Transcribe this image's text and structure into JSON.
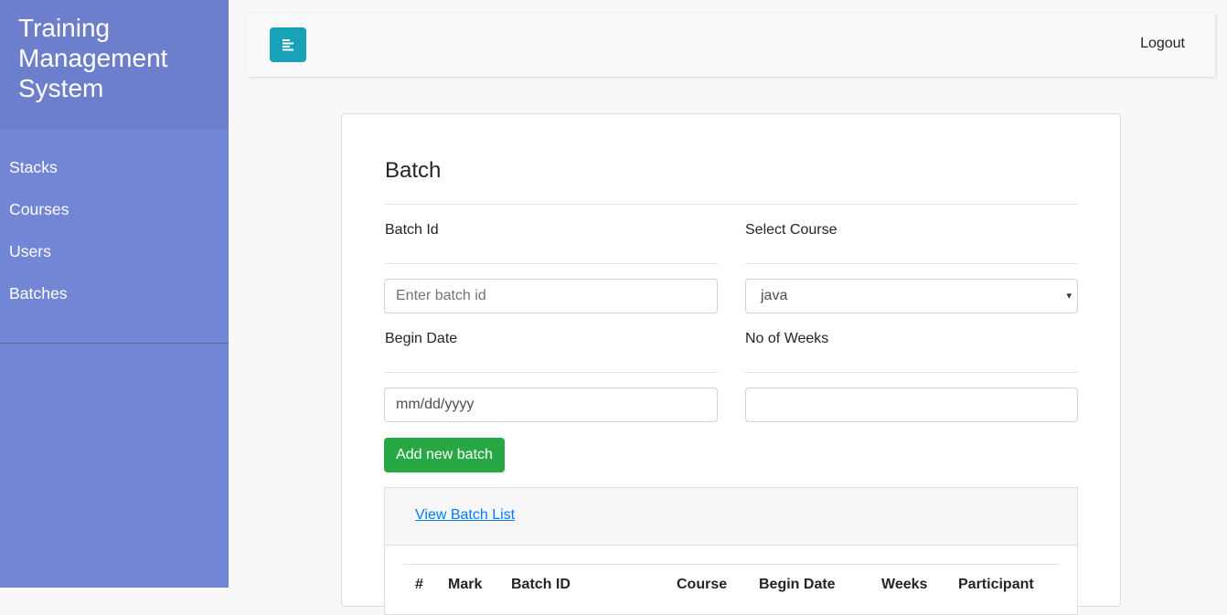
{
  "sidebar": {
    "title": "Training Management System",
    "items": [
      {
        "label": "Stacks"
      },
      {
        "label": "Courses"
      },
      {
        "label": "Users"
      },
      {
        "label": "Batches"
      }
    ]
  },
  "topbar": {
    "toggle_icon": "menu-align-left-icon",
    "logout_label": "Logout"
  },
  "form": {
    "title": "Batch",
    "batch_id_label": "Batch Id",
    "batch_id_placeholder": "Enter batch id",
    "select_course_label": "Select Course",
    "select_course_value": "java",
    "begin_date_label": "Begin Date",
    "begin_date_placeholder": "mm/dd/yyyy",
    "weeks_label": "No of Weeks",
    "weeks_value": "",
    "add_button_label": "Add new batch"
  },
  "batch_list": {
    "link_label": "View Batch List",
    "columns": [
      "#",
      "Mark",
      "Batch ID",
      "Course",
      "Begin Date",
      "Weeks",
      "Participant"
    ]
  },
  "colors": {
    "sidebar": "#7386d5",
    "sidebar_header": "#6d7fcc",
    "toggle": "#17a2b8",
    "add_button": "#28a745",
    "link": "#007bff"
  }
}
